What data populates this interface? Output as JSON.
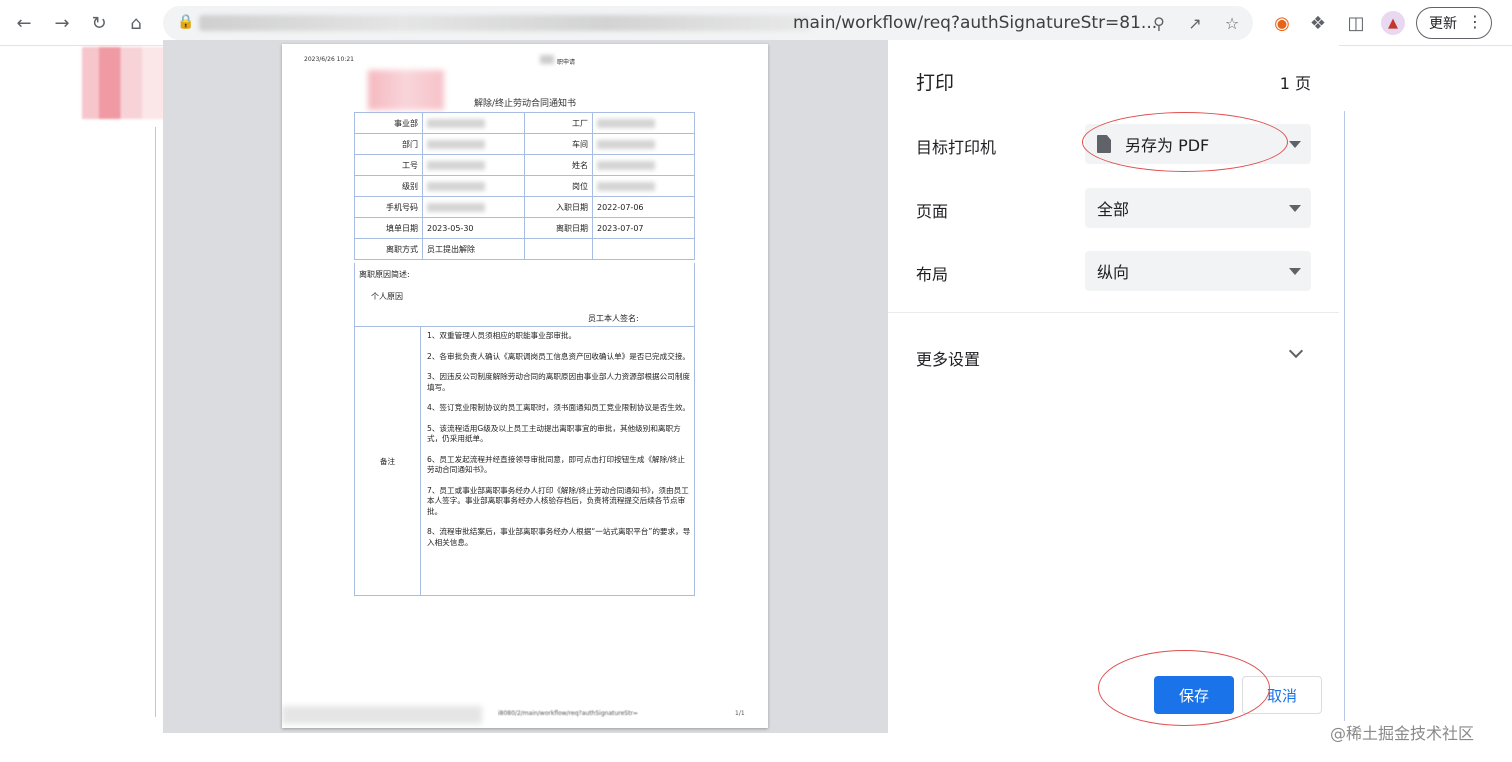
{
  "browser": {
    "url_visible": "main/workflow/req?authSignatureStr=81...",
    "update_label": "更新",
    "icons": [
      "back-icon",
      "forward-icon",
      "reload-icon",
      "home-icon",
      "lock-icon",
      "zoom-icon",
      "share-icon",
      "star-icon",
      "extension-icon",
      "puzzle-icon",
      "sidebar-icon",
      "profile-icon",
      "more-icon"
    ]
  },
  "preview": {
    "header_date": "2023/6/26 10:21",
    "header_title": "职申请",
    "doc_title": "解除/终止劳动合同通知书",
    "form_rows": [
      {
        "l1": "事业部",
        "l2": "工厂",
        "v2": ""
      },
      {
        "l1": "部门",
        "l2": "车间",
        "v2": ""
      },
      {
        "l1": "工号",
        "l2": "姓名",
        "v2": ""
      },
      {
        "l1": "级别",
        "l2": "岗位",
        "v2": ""
      },
      {
        "l1": "手机号码",
        "l2": "入职日期",
        "v2": "2022-07-06"
      },
      {
        "l1": "填单日期",
        "v1": "2023-05-30",
        "l2": "离职日期",
        "v2": "2023-07-07"
      },
      {
        "l1": "离职方式",
        "v1": "员工提出解除",
        "l2": "",
        "v2": ""
      }
    ],
    "reason_label": "离职原因简述:",
    "reason_value": "个人原因",
    "signature_label": "员工本人签名:",
    "notes_label": "备注",
    "notes": [
      "1、双重管理人员须相应的职能事业部审批。",
      "2、各审批负责人确认《离职调岗员工信息资产回收确认单》是否已完成交接。",
      "3、因违反公司制度解除劳动合同的离职原因由事业部人力资源部根据公司制度填写。",
      "4、签订竞业限制协议的员工离职时，须书面通知员工竞业限制协议是否生效。",
      "5、该流程适用G级及以上员工主动提出离职事宜的审批，其他级别和离职方式，仍采用纸单。",
      "6、员工发起流程并经直接领导审批同意，即可点击打印按钮生成《解除/终止劳动合同通知书》。",
      "7、员工或事业部离职事务经办人打印《解除/终止劳动合同通知书》，须由员工本人签字。事业部离职事务经办人核验存档后，负责将流程提交后续各节点审批。",
      "8、流程审批结案后，事业部离职事务经办人根据“一站式离职平台”的要求，导入相关信息。"
    ],
    "footer_url": "i8080/2/main/workflow/req?authSignatureStr=",
    "footer_page": "1/1"
  },
  "print": {
    "title": "打印",
    "pages": "1 页",
    "printer_label": "目标打印机",
    "printer_value": "另存为 PDF",
    "pages_label": "页面",
    "pages_value": "全部",
    "layout_label": "布局",
    "layout_value": "纵向",
    "more_settings": "更多设置",
    "save": "保存",
    "cancel": "取消"
  },
  "watermark": "@稀土掘金技术社区",
  "colors": {
    "accent": "#1a73e8",
    "annotation": "#e05050",
    "table_border": "#a9bde3"
  }
}
